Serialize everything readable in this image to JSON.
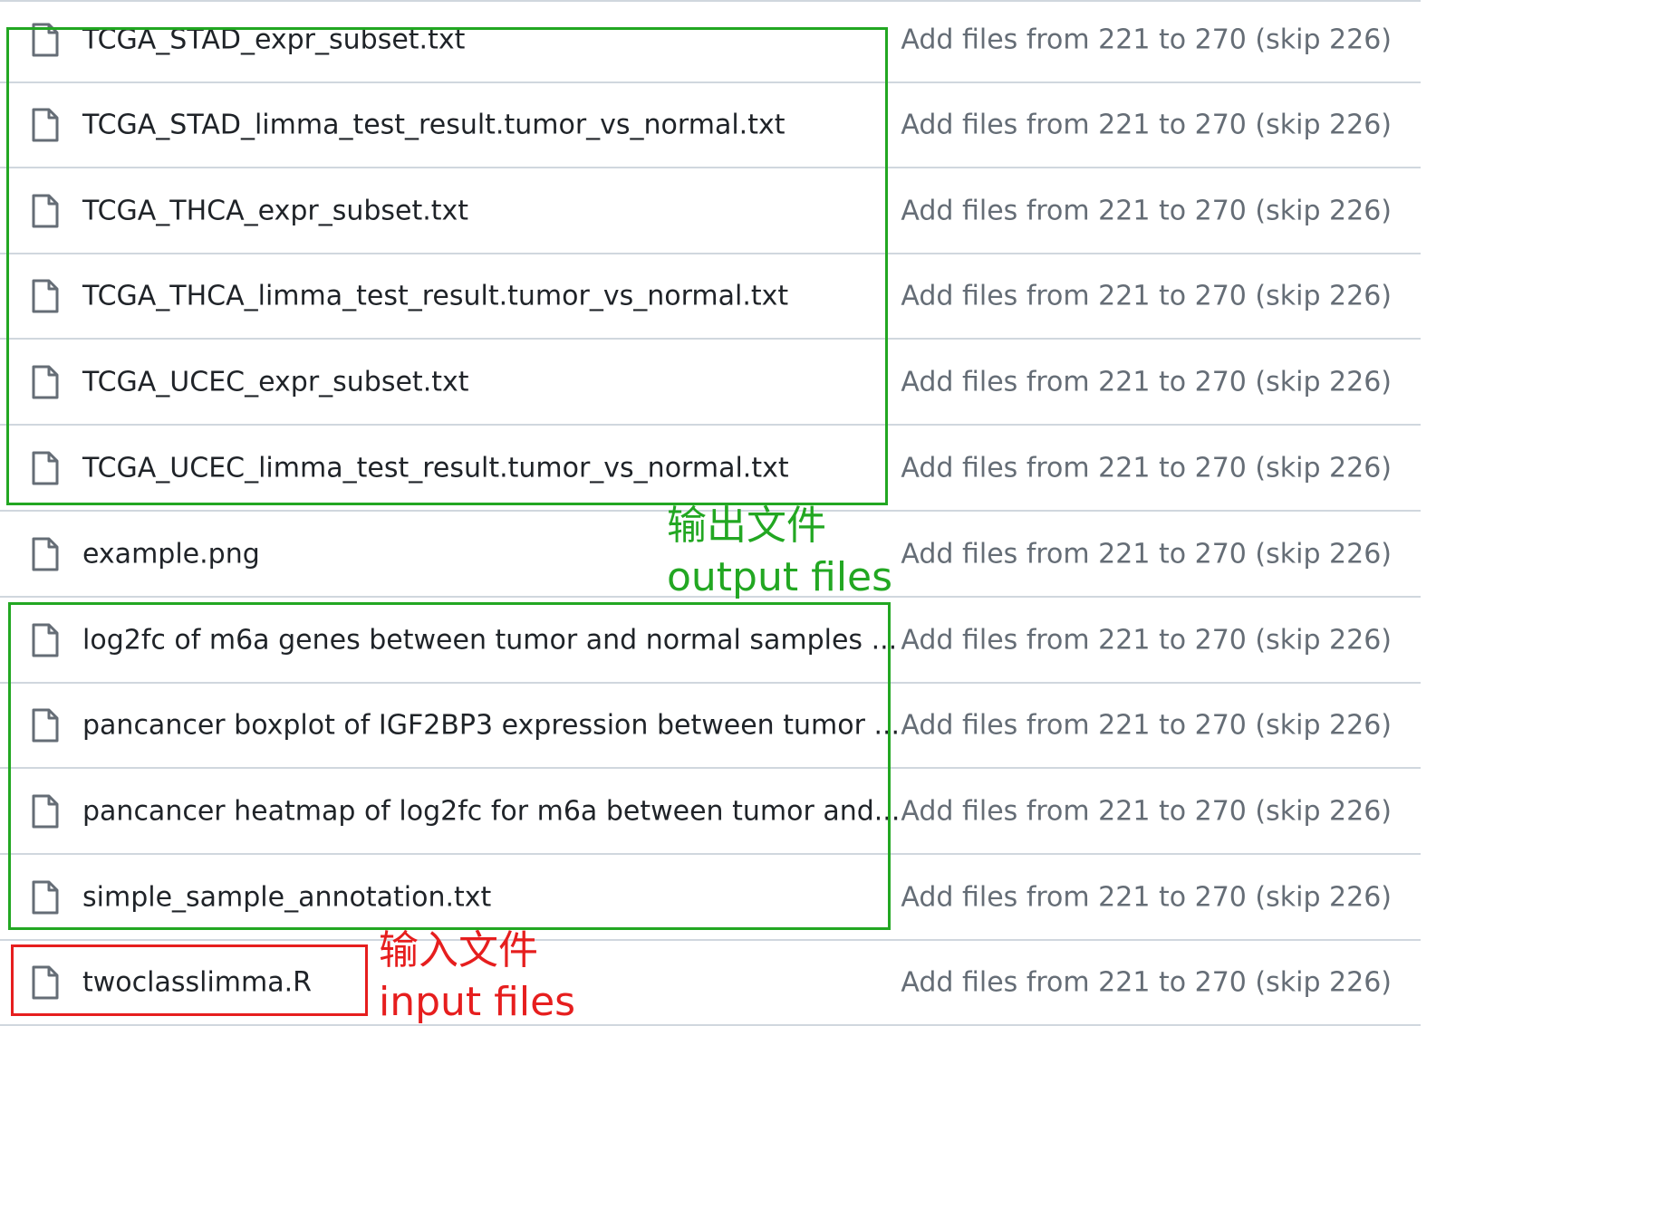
{
  "files": [
    {
      "name": "TCGA_STAD_expr_subset.txt",
      "icon": "file-icon",
      "commit": "Add files from 221 to 270 (skip 226)"
    },
    {
      "name": "TCGA_STAD_limma_test_result.tumor_vs_normal.txt",
      "icon": "file-icon",
      "commit": "Add files from 221 to 270 (skip 226)"
    },
    {
      "name": "TCGA_THCA_expr_subset.txt",
      "icon": "file-icon",
      "commit": "Add files from 221 to 270 (skip 226)"
    },
    {
      "name": "TCGA_THCA_limma_test_result.tumor_vs_normal.txt",
      "icon": "file-icon",
      "commit": "Add files from 221 to 270 (skip 226)"
    },
    {
      "name": "TCGA_UCEC_expr_subset.txt",
      "icon": "file-icon",
      "commit": "Add files from 221 to 270 (skip 226)"
    },
    {
      "name": "TCGA_UCEC_limma_test_result.tumor_vs_normal.txt",
      "icon": "file-icon",
      "commit": "Add files from 221 to 270 (skip 226)"
    },
    {
      "name": "example.png",
      "icon": "file-icon",
      "commit": "Add files from 221 to 270 (skip 226)"
    },
    {
      "name": "log2fc of m6a genes between tumor and normal samples ...",
      "icon": "file-icon",
      "commit": "Add files from 221 to 270 (skip 226)"
    },
    {
      "name": "pancancer boxplot of IGF2BP3 expression between tumor ...",
      "icon": "file-icon",
      "commit": "Add files from 221 to 270 (skip 226)"
    },
    {
      "name": "pancancer heatmap of log2fc for m6a between tumor and...",
      "icon": "file-icon",
      "commit": "Add files from 221 to 270 (skip 226)"
    },
    {
      "name": "simple_sample_annotation.txt",
      "icon": "file-icon",
      "commit": "Add files from 221 to 270 (skip 226)"
    },
    {
      "name": "twoclasslimma.R",
      "icon": "file-icon",
      "commit": "Add files from 221 to 270 (skip 226)"
    }
  ],
  "annotations": {
    "output": {
      "zh": "输出文件",
      "en": "output files",
      "color": "#22a722"
    },
    "input": {
      "zh": "输入文件",
      "en": "input files",
      "color": "#e61e1e"
    }
  },
  "colors": {
    "border": "#d0d7de",
    "file_name": "#1f2328",
    "commit_text": "#656d76",
    "icon": "#656d76"
  }
}
